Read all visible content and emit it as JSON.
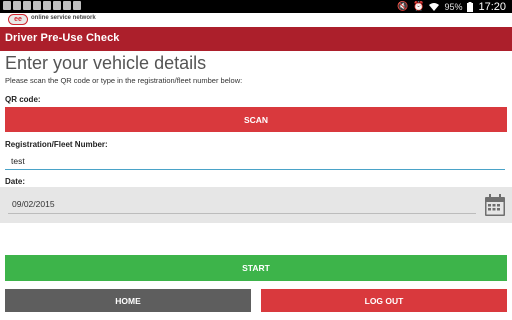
{
  "status_bar": {
    "battery": "95%",
    "time": "17:20"
  },
  "brand": {
    "logo": "ee",
    "tagline": "online service network"
  },
  "app_bar": {
    "title": "Driver Pre-Use Check"
  },
  "page": {
    "heading": "Enter your vehicle details",
    "instructions": "Please scan the QR code or type in the registration/fleet number below:"
  },
  "qr": {
    "label": "QR code:",
    "scan_button": "SCAN"
  },
  "registration": {
    "label": "Registration/Fleet Number:",
    "value": "test"
  },
  "date": {
    "label": "Date:",
    "value": "09/02/2015"
  },
  "buttons": {
    "start": "START",
    "home": "HOME",
    "logout": "LOG OUT"
  },
  "colors": {
    "app_bar": "#ac1f2b",
    "scan": "#d9393d",
    "start": "#3db44a",
    "home": "#5e5e5e",
    "logout": "#d9393d"
  }
}
